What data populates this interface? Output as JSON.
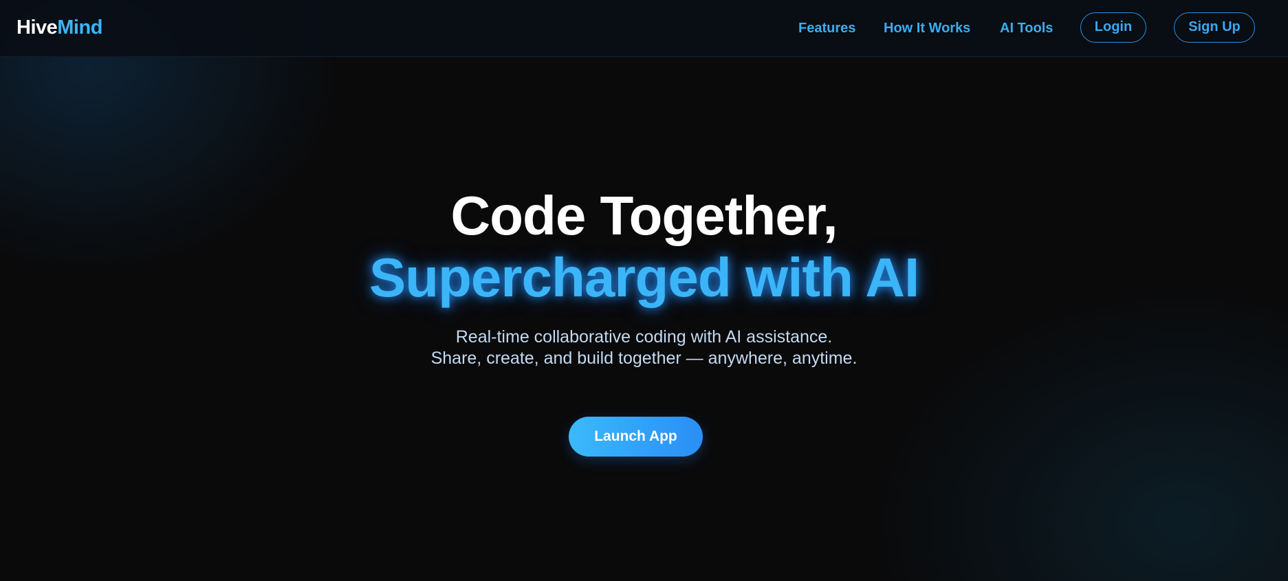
{
  "nav": {
    "logo_part1": "Hive",
    "logo_part2": "Mind",
    "links": [
      "Features",
      "How It Works",
      "AI Tools"
    ],
    "login_label": "Login",
    "signup_label": "Sign Up"
  },
  "hero": {
    "title_line1": "Code Together,",
    "title_line2": "Supercharged with AI",
    "subtitle_line1": "Real-time collaborative coding with AI assistance.",
    "subtitle_line2": "Share, create, and build together — anywhere, anytime.",
    "cta_label": "Launch App"
  },
  "colors": {
    "accent": "#3bb5f8",
    "background": "#0a0a0b",
    "cta_gradient_start": "#3bb9fb",
    "cta_gradient_end": "#2a8ef6"
  }
}
